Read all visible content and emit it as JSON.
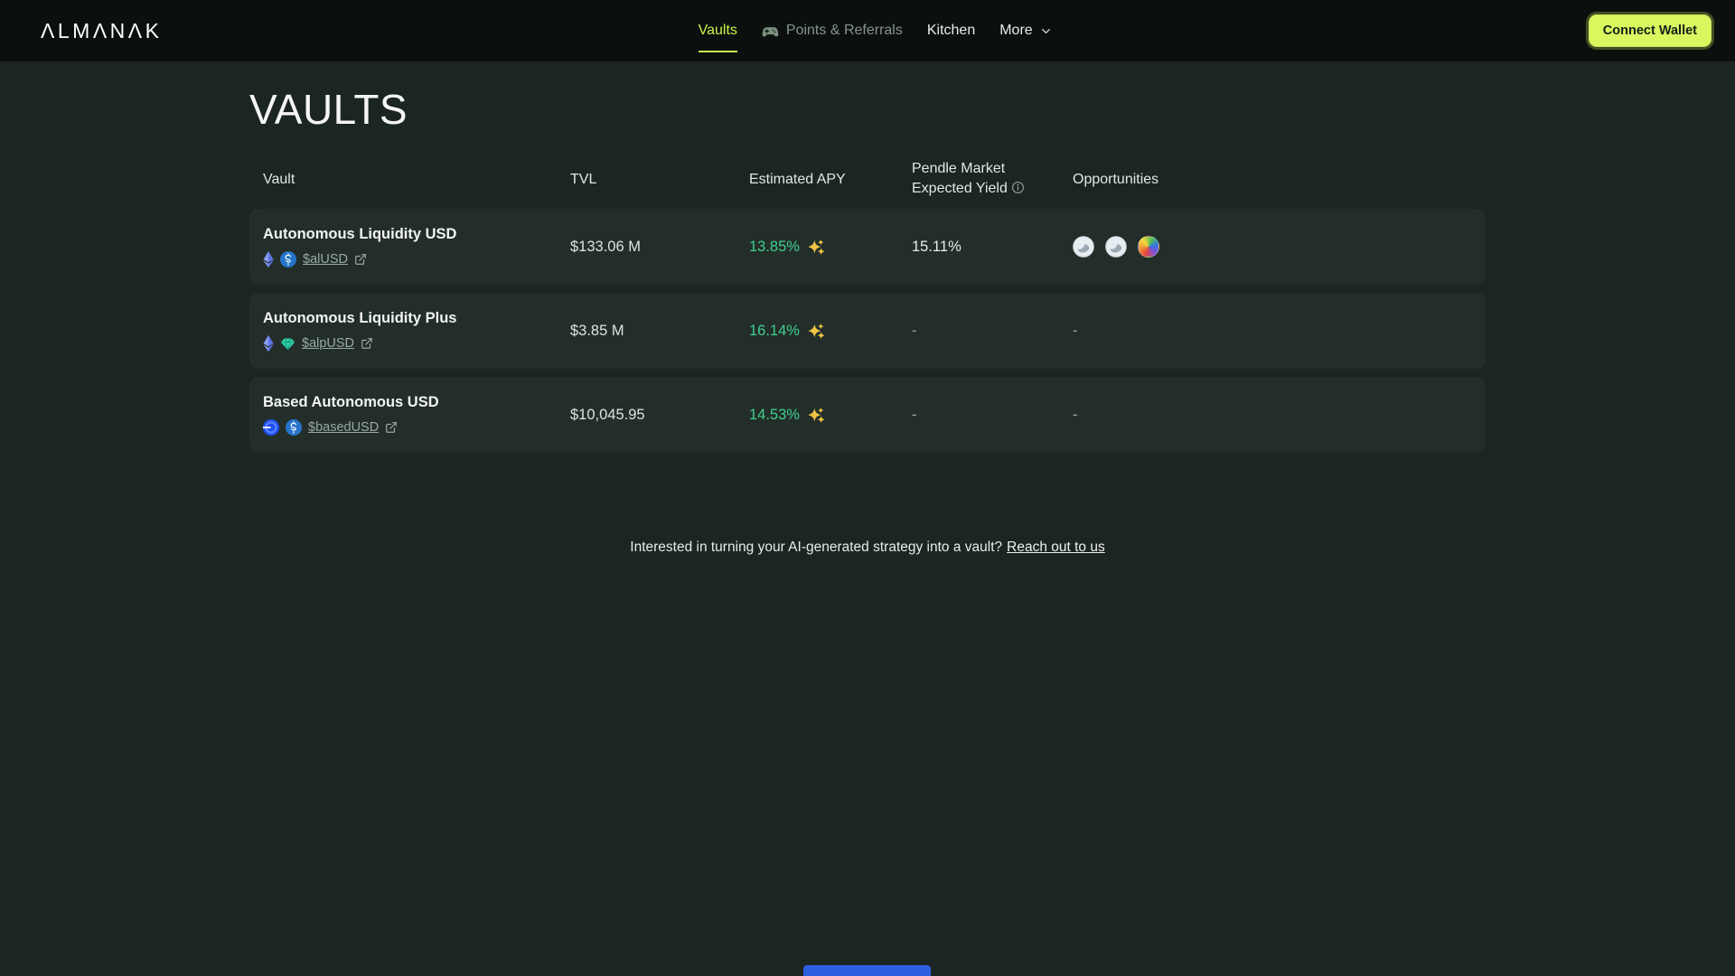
{
  "nav": {
    "logo": "ΛLMΛNΛK",
    "items": [
      {
        "label": "Vaults",
        "active": true
      },
      {
        "label": "Points & Referrals",
        "active": false
      },
      {
        "label": "Kitchen",
        "active": false
      },
      {
        "label": "More",
        "active": false
      }
    ],
    "connect_wallet_label": "Connect Wallet"
  },
  "page": {
    "title": "VAULTS"
  },
  "table": {
    "headers": [
      "Vault",
      "TVL",
      "Estimated APY",
      "Pendle Market Expected Yield",
      "Opportunities"
    ],
    "rows": [
      {
        "name": "Autonomous Liquidity USD",
        "token": "$alUSD",
        "token_icons": [
          "ethereum-icon",
          "usdc-icon"
        ],
        "tvl": "$133.06 M",
        "apy": "13.85%",
        "pendle_yield": "15.11%",
        "opportunity_icons": [
          "pendle-icon",
          "pendle-icon",
          "rainbow-icon"
        ]
      },
      {
        "name": "Autonomous Liquidity Plus",
        "token": "$alpUSD",
        "token_icons": [
          "ethereum-icon",
          "gem-icon"
        ],
        "tvl": "$3.85 M",
        "apy": "16.14%",
        "pendle_yield": "-",
        "opportunities": "-"
      },
      {
        "name": "Based Autonomous USD",
        "token": "$basedUSD",
        "token_icons": [
          "base-icon",
          "usdc-icon"
        ],
        "tvl": "$10,045.95",
        "apy": "14.53%",
        "pendle_yield": "-",
        "opportunities": "-"
      }
    ]
  },
  "footer": {
    "text": "Interested in turning your AI-generated strategy into a vault?",
    "link_label": "Reach out to us"
  },
  "colors": {
    "background": "#1b2522",
    "navbar": "#0b100e",
    "row_background": "#232e2a",
    "accent_lime": "#d9f85f",
    "nav_active_lime": "#c9f24b",
    "apy_green": "#3fcf8e",
    "muted_text": "#9aa9a3",
    "usdc_blue": "#2775ca",
    "base_blue": "#1d4ef2",
    "ethereum_purple": "#5e74e6",
    "gem_teal": "#2fd0a6",
    "bottom_bar_blue": "#2e5fe0"
  }
}
